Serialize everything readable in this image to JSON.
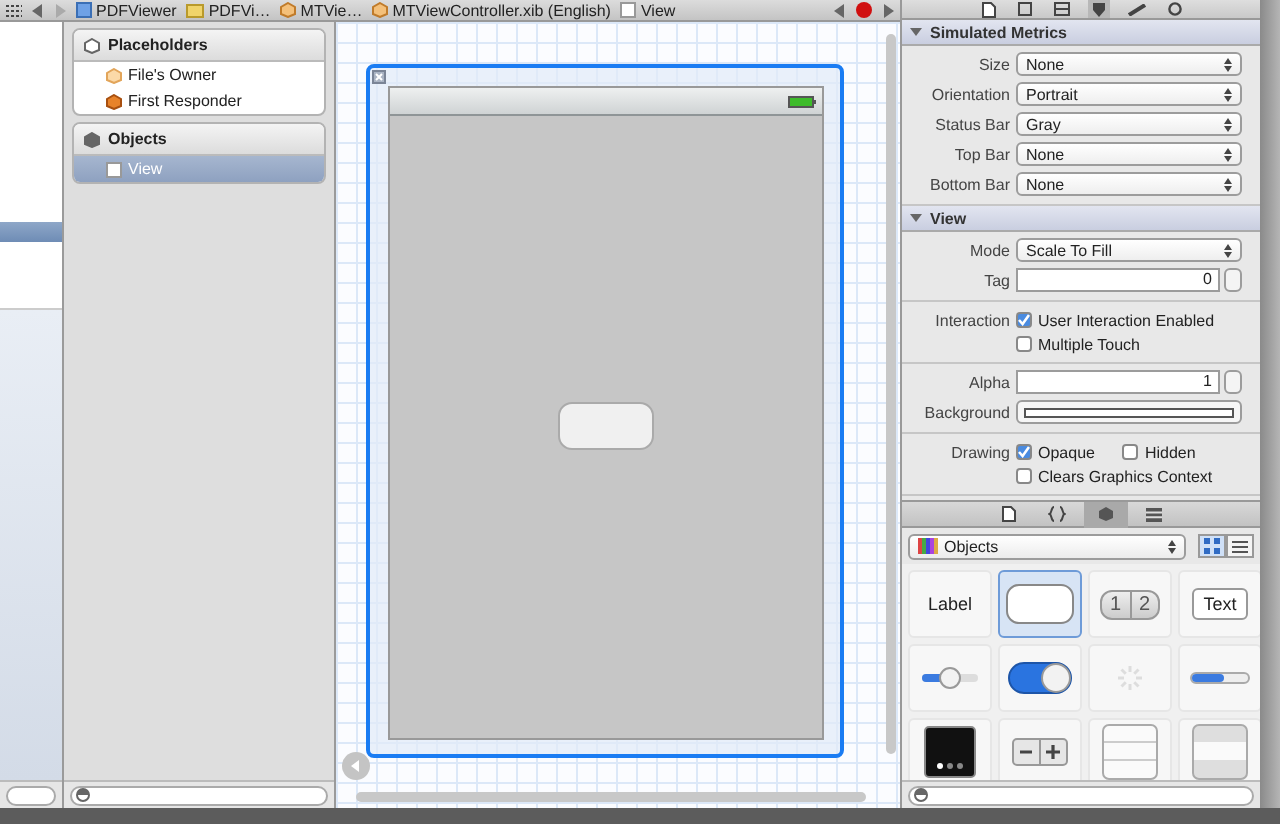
{
  "jump_bar": {
    "items": [
      {
        "kind": "project",
        "label": "PDFViewer"
      },
      {
        "kind": "folder",
        "label": "PDFVi…"
      },
      {
        "kind": "xib",
        "label": "MTVie…"
      },
      {
        "kind": "xib",
        "label": "MTViewController.xib (English)"
      },
      {
        "kind": "view",
        "label": "View"
      }
    ]
  },
  "outline": {
    "sections": [
      {
        "title": "Placeholders",
        "items": [
          {
            "kind": "owner",
            "label": "File's Owner",
            "selected": false
          },
          {
            "kind": "responder",
            "label": "First Responder",
            "selected": false
          }
        ]
      },
      {
        "title": "Objects",
        "items": [
          {
            "kind": "view",
            "label": "View",
            "selected": true
          }
        ]
      }
    ]
  },
  "inspector": {
    "tabs": [
      {
        "kind": "file",
        "selected": false
      },
      {
        "kind": "help",
        "selected": false
      },
      {
        "kind": "identity",
        "selected": false
      },
      {
        "kind": "attributes",
        "selected": true
      },
      {
        "kind": "size",
        "selected": false
      },
      {
        "kind": "connections",
        "selected": false
      }
    ],
    "sections": [
      {
        "title": "Simulated Metrics",
        "expanded": true,
        "groups": [
          [
            {
              "kind": "select",
              "label": "Size",
              "value": "None"
            },
            {
              "kind": "select",
              "label": "Orientation",
              "value": "Portrait"
            },
            {
              "kind": "select",
              "label": "Status Bar",
              "value": "Gray"
            },
            {
              "kind": "select",
              "label": "Top Bar",
              "value": "None"
            },
            {
              "kind": "select",
              "label": "Bottom Bar",
              "value": "None"
            }
          ]
        ]
      },
      {
        "title": "View",
        "expanded": true,
        "groups": [
          [
            {
              "kind": "select",
              "label": "Mode",
              "value": "Scale To Fill"
            },
            {
              "kind": "stepper",
              "label": "Tag",
              "value": "0"
            }
          ],
          [
            {
              "kind": "checks",
              "label": "Interaction",
              "lines": [
                [
                  {
                    "label": "User Interaction Enabled",
                    "checked": true
                  }
                ],
                [
                  {
                    "label": "Multiple Touch",
                    "checked": false
                  }
                ]
              ]
            }
          ],
          [
            {
              "kind": "stepper",
              "label": "Alpha",
              "value": "1"
            },
            {
              "kind": "color",
              "label": "Background"
            }
          ],
          [
            {
              "kind": "checks",
              "label": "Drawing",
              "lines": [
                [
                  {
                    "label": "Opaque",
                    "checked": true
                  },
                  {
                    "label": "Hidden",
                    "checked": false
                  }
                ],
                [
                  {
                    "label": "Clears Graphics Context",
                    "checked": false
                  }
                ]
              ]
            }
          ]
        ]
      }
    ]
  },
  "library": {
    "tabs": [
      {
        "kind": "file",
        "selected": false
      },
      {
        "kind": "code",
        "selected": false
      },
      {
        "kind": "objects",
        "selected": true
      },
      {
        "kind": "media",
        "selected": false
      }
    ],
    "filter": {
      "value": "Objects"
    },
    "view_modes": [
      {
        "kind": "grid",
        "selected": true
      },
      {
        "kind": "list",
        "selected": false
      }
    ],
    "objects": [
      {
        "kind": "label",
        "text": "Label",
        "selected": false
      },
      {
        "kind": "round-button",
        "selected": true
      },
      {
        "kind": "segmented",
        "segments": [
          "1",
          "2"
        ],
        "selected": false
      },
      {
        "kind": "text-field",
        "text": "Text",
        "selected": false
      },
      {
        "kind": "slider",
        "selected": false
      },
      {
        "kind": "switch",
        "selected": false
      },
      {
        "kind": "activity",
        "selected": false
      },
      {
        "kind": "progress",
        "selected": false
      },
      {
        "kind": "page-control",
        "selected": false
      },
      {
        "kind": "stepper",
        "selected": false
      },
      {
        "kind": "table",
        "selected": false
      },
      {
        "kind": "grouped-table",
        "selected": false
      }
    ]
  }
}
